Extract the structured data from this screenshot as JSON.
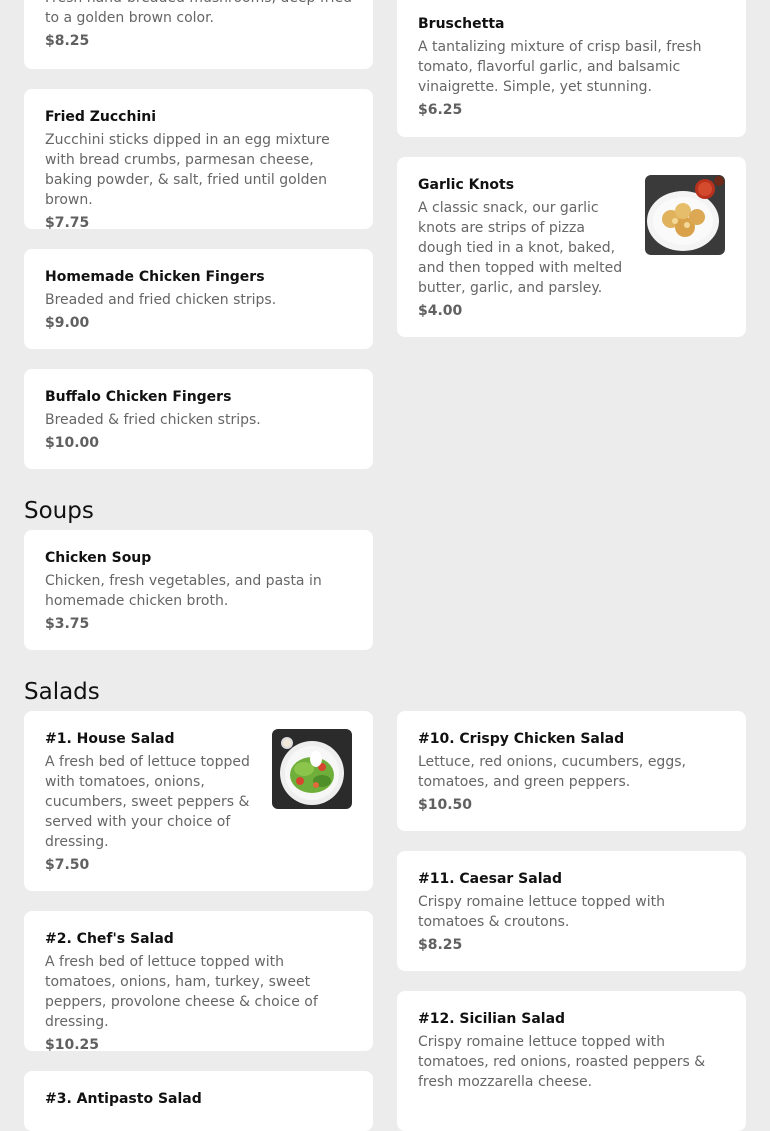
{
  "sections": {
    "soups_title": "Soups",
    "salads_title": "Salads"
  },
  "items": {
    "mushrooms": {
      "desc": "Fresh hand-breaded mushrooms, deep fried to a golden brown color.",
      "price": "$8.25"
    },
    "bruschetta": {
      "name": "Bruschetta",
      "desc": "A tantalizing mixture of crisp basil, fresh tomato, flavorful garlic, and balsamic vinaigrette. Simple, yet stunning.",
      "price": "$6.25"
    },
    "fried_zucchini": {
      "name": "Fried Zucchini",
      "desc": "Zucchini sticks dipped in an egg mixture with bread crumbs, parmesan cheese, baking powder, & salt, fried until golden brown.",
      "price": "$7.75"
    },
    "garlic_knots": {
      "name": "Garlic Knots",
      "desc": "A classic snack, our garlic knots are strips of pizza dough tied in a knot, baked, and then topped with melted butter, garlic, and parsley.",
      "price": "$4.00"
    },
    "homemade_chicken_fingers": {
      "name": "Homemade Chicken Fingers",
      "desc": "Breaded and fried chicken strips.",
      "price": "$9.00"
    },
    "buffalo_chicken_fingers": {
      "name": "Buffalo Chicken Fingers",
      "desc": "Breaded & fried chicken strips.",
      "price": "$10.00"
    },
    "chicken_soup": {
      "name": "Chicken Soup",
      "desc": "Chicken, fresh vegetables, and pasta in homemade chicken broth.",
      "price": "$3.75"
    },
    "house_salad": {
      "name": "#1. House Salad",
      "desc": "A fresh bed of lettuce topped with tomatoes, onions, cucumbers, sweet peppers & served with your choice of dressing.",
      "price": "$7.50"
    },
    "crispy_chicken_salad": {
      "name": "#10. Crispy Chicken Salad",
      "desc": "Lettuce, red onions, cucumbers, eggs, tomatoes, and green peppers.",
      "price": "$10.50"
    },
    "chefs_salad": {
      "name": "#2. Chef's Salad",
      "desc": "A fresh bed of lettuce topped with tomatoes, onions, ham, turkey, sweet peppers, provolone cheese & choice of dressing.",
      "price": "$10.25"
    },
    "caesar_salad": {
      "name": "#11. Caesar Salad",
      "desc": "Crispy romaine lettuce topped with tomatoes & croutons.",
      "price": "$8.25"
    },
    "sicilian_salad": {
      "name": "#12. Sicilian Salad",
      "desc": "Crispy romaine lettuce topped with tomatoes, red onions, roasted peppers & fresh mozzarella cheese."
    },
    "antipasto_salad": {
      "name": "#3. Antipasto Salad"
    }
  },
  "colors": {
    "background": "#ececec",
    "card": "#ffffff",
    "description_text": "#666666",
    "price_text": "#606060"
  },
  "icons": {
    "garlic_knots_photo": "garlic-knots-photo",
    "house_salad_photo": "house-salad-photo"
  }
}
